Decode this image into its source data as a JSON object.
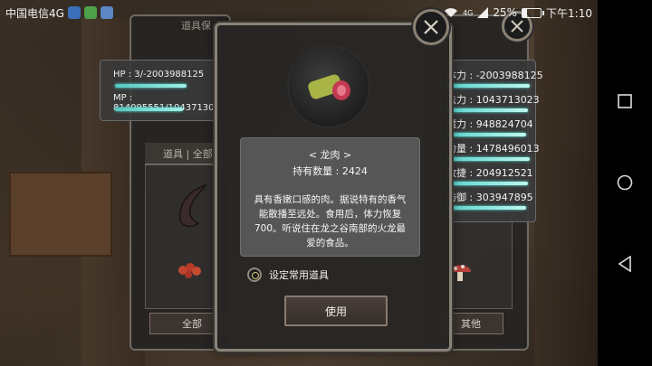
{
  "status_bar": {
    "carrier": "中国电信4G",
    "signal_tag": "4G",
    "battery_percent": "25%",
    "battery_level": 0.25,
    "time": "下午1:10"
  },
  "left_panel": {
    "title": "道具保",
    "hp_label": "HP : 3/-2003988125",
    "mp_label": "MP : 814095551/10437130",
    "hp_fill": 0.72,
    "mp_fill": 0.68,
    "tabs_label": "道具 | 全部",
    "bottom_button": "全部"
  },
  "right_panel": {
    "stats": [
      {
        "label": "体力 : -2003988125"
      },
      {
        "label": "法力 : 1043713023"
      },
      {
        "label": "魔力 : 948824704"
      },
      {
        "label": "力量 : 1478496013"
      },
      {
        "label": "敏捷 : 204912521"
      },
      {
        "label": "防御 : 303947895"
      }
    ],
    "bottom_button": "其他"
  },
  "dialog": {
    "item_name": "< 龙肉 >",
    "quantity_label": "持有数量 :",
    "quantity_value": "2424",
    "description": "具有香嫩口感的肉。据说特有的香气能散播至远处。食用后，体力恢复700。听说住在龙之谷南部的火龙最爱的食品。",
    "favorite_label": "设定常用道具",
    "use_button": "使用"
  },
  "colors": {
    "bar_accent": "#7fe6dc",
    "panel_bg": "#262422",
    "dialog_border": "#8a8379"
  },
  "icons": [
    "close-icon",
    "meat-icon",
    "horn-icon",
    "berries-icon",
    "mushroom-icon",
    "wifi-icon",
    "signal-icon",
    "battery-icon",
    "nav-square-icon",
    "nav-circle-icon",
    "nav-triangle-icon"
  ]
}
